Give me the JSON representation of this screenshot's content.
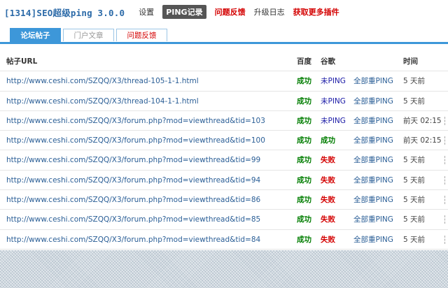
{
  "header": {
    "app_title": "[1314]SEO超级ping 3.0.0",
    "nav": [
      {
        "label": "设置"
      },
      {
        "label": "PING记录"
      },
      {
        "label": "问题反馈"
      },
      {
        "label": "升级日志"
      },
      {
        "label": "获取更多插件"
      }
    ]
  },
  "tabs": [
    {
      "label": "论坛帖子"
    },
    {
      "label": "门户文章"
    },
    {
      "label": "问题反馈"
    }
  ],
  "table": {
    "columns": {
      "url": "帖子URL",
      "baidu": "百度",
      "google": "谷歌",
      "time": "时间"
    },
    "rows": [
      {
        "url": "http://www.ceshi.com/SZQQ/X3/thread-105-1-1.html",
        "baidu": "成功",
        "google": "未PING",
        "action": "全部重PING",
        "time": "5 天前"
      },
      {
        "url": "http://www.ceshi.com/SZQQ/X3/thread-104-1-1.html",
        "baidu": "成功",
        "google": "未PING",
        "action": "全部重PING",
        "time": "5 天前"
      },
      {
        "url": "http://www.ceshi.com/SZQQ/X3/forum.php?mod=viewthread&tid=103",
        "baidu": "成功",
        "google": "未PING",
        "action": "全部重PING",
        "time": "前天 02:15"
      },
      {
        "url": "http://www.ceshi.com/SZQQ/X3/forum.php?mod=viewthread&tid=100",
        "baidu": "成功",
        "google": "成功",
        "action": "全部重PING",
        "time": "前天 02:15"
      },
      {
        "url": "http://www.ceshi.com/SZQQ/X3/forum.php?mod=viewthread&tid=99",
        "baidu": "成功",
        "google": "失败",
        "action": "全部重PING",
        "time": "5 天前"
      },
      {
        "url": "http://www.ceshi.com/SZQQ/X3/forum.php?mod=viewthread&tid=94",
        "baidu": "成功",
        "google": "失败",
        "action": "全部重PING",
        "time": "5 天前"
      },
      {
        "url": "http://www.ceshi.com/SZQQ/X3/forum.php?mod=viewthread&tid=86",
        "baidu": "成功",
        "google": "失败",
        "action": "全部重PING",
        "time": "5 天前"
      },
      {
        "url": "http://www.ceshi.com/SZQQ/X3/forum.php?mod=viewthread&tid=85",
        "baidu": "成功",
        "google": "失败",
        "action": "全部重PING",
        "time": "5 天前"
      },
      {
        "url": "http://www.ceshi.com/SZQQ/X3/forum.php?mod=viewthread&tid=84",
        "baidu": "成功",
        "google": "失败",
        "action": "全部重PING",
        "time": "5 天前"
      }
    ]
  },
  "colors": {
    "accent": "#3d97d9",
    "success": "#007d00",
    "fail": "#d40000",
    "link": "#2a5e96"
  }
}
